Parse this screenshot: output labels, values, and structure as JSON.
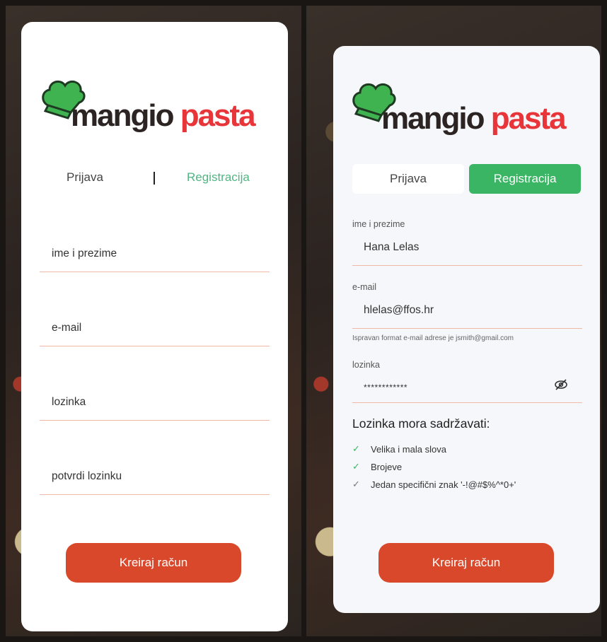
{
  "brand": {
    "word1": "mangio",
    "word2": "pasta",
    "colors": {
      "dark": "#2b2422",
      "red": "#e8353a",
      "hat": "#3fb34f"
    }
  },
  "left_screen": {
    "tabs": {
      "login": "Prijava",
      "separator": "|",
      "register": "Registracija"
    },
    "fields": {
      "full_name_placeholder": "ime i prezime",
      "email_placeholder": "e-mail",
      "password_placeholder": "lozinka",
      "confirm_password_placeholder": "potvrdi lozinku"
    },
    "button_label": "Kreiraj račun"
  },
  "right_screen": {
    "tabs": {
      "login": "Prijava",
      "register": "Registracija",
      "active": "register"
    },
    "fields": {
      "full_name_label": "ime i prezime",
      "full_name_value": "Hana Lelas",
      "email_label": "e-mail",
      "email_value": "hlelas@ffos.hr",
      "email_hint": "Ispravan format e-mail adrese je jsmith@gmail.com",
      "password_label": "lozinka",
      "password_value": "************"
    },
    "requirements": {
      "title": "Lozinka mora sadržavati:",
      "items": [
        {
          "label": "Velika i mala slova",
          "met": true
        },
        {
          "label": "Brojeve",
          "met": true
        },
        {
          "label": "Jedan specifični znak '-!@#$%^*0+'",
          "met": false
        }
      ]
    },
    "button_label": "Kreiraj račun",
    "colors": {
      "accent": "#39b564",
      "button": "#d9482b"
    }
  }
}
